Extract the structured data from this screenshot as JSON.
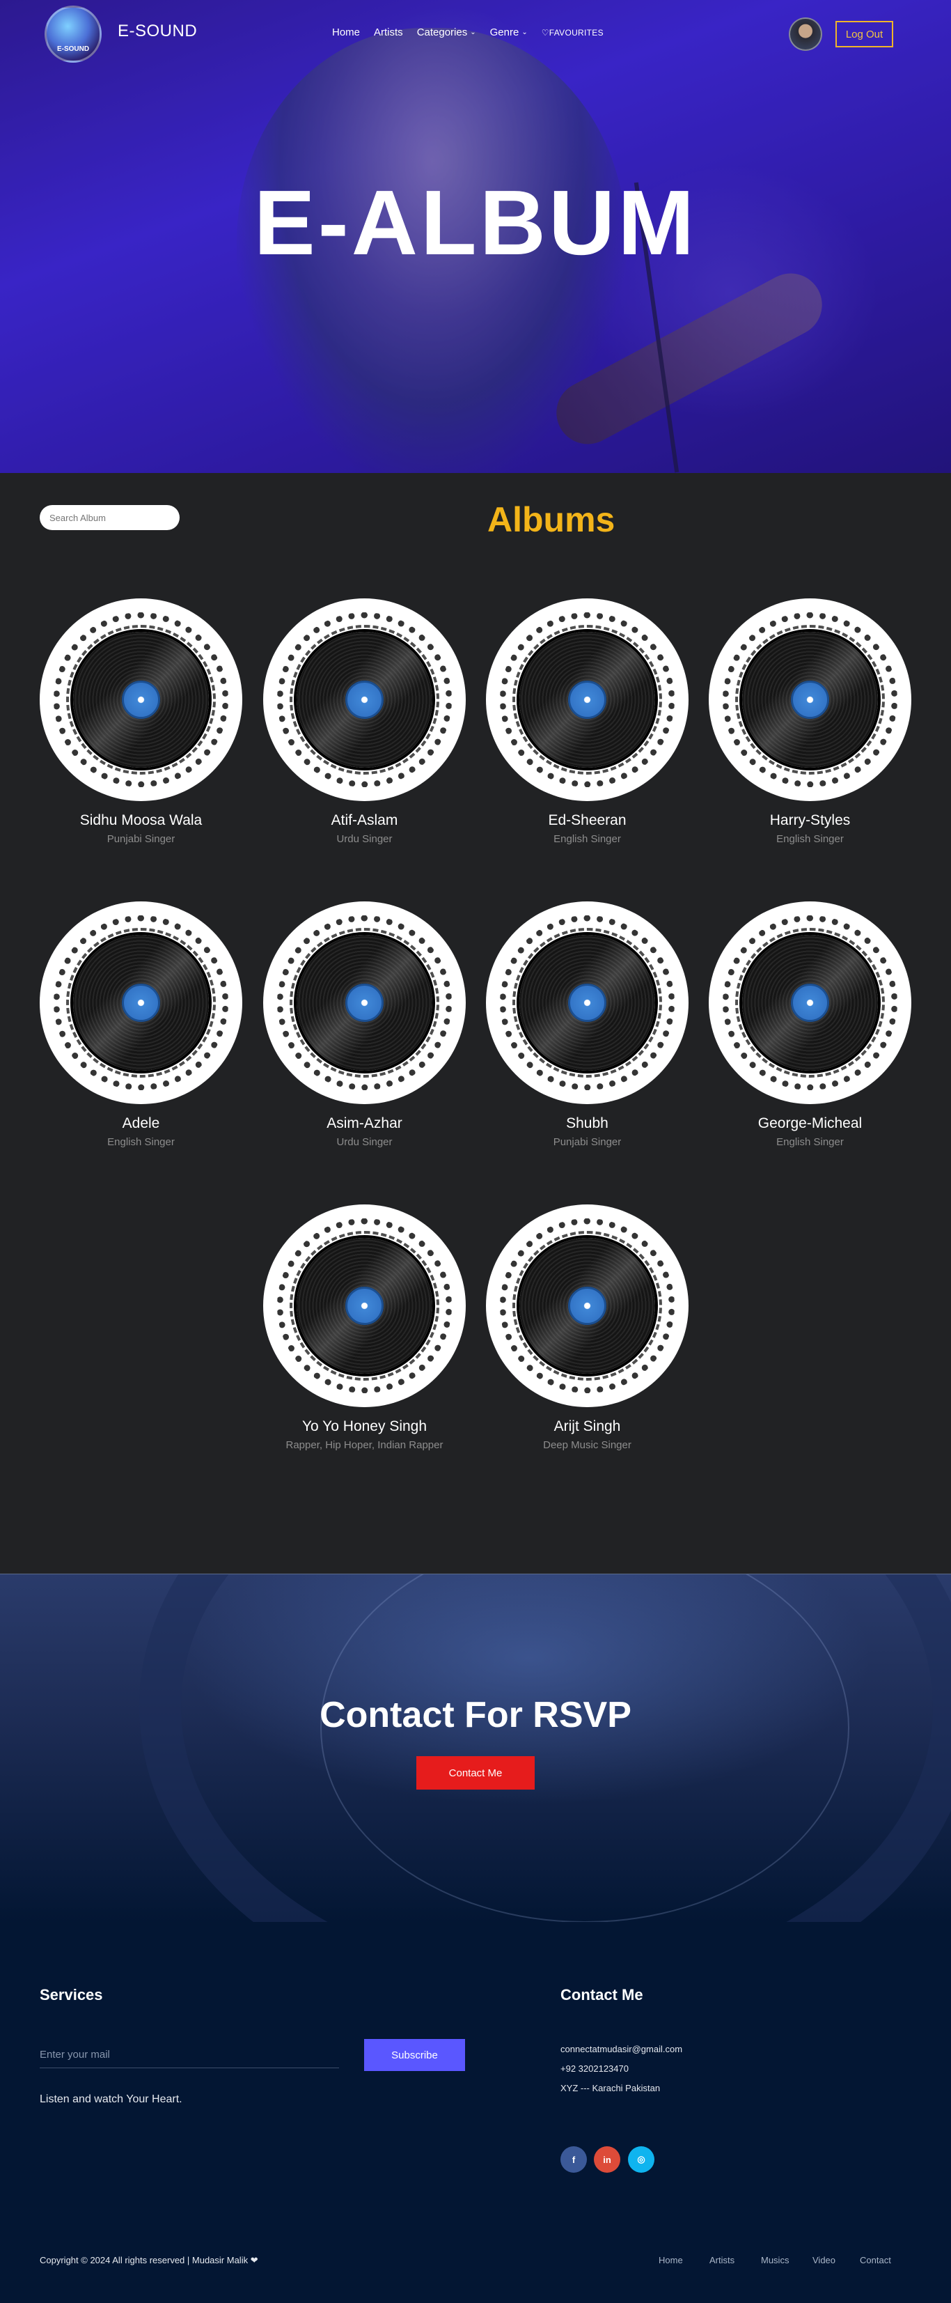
{
  "nav": {
    "logo_text": "E-SOUND",
    "brand": "E-SOUND",
    "links": [
      {
        "label": "Home"
      },
      {
        "label": "Artists"
      },
      {
        "label": "Categories",
        "dropdown": true
      },
      {
        "label": "Genre",
        "dropdown": true
      },
      {
        "label": "♡FAVOURITES"
      }
    ],
    "logout_label": "Log Out"
  },
  "hero": {
    "title": "E-ALBUM"
  },
  "albums": {
    "search_placeholder": "Search Album",
    "title": "Albums",
    "items": [
      {
        "name": "Sidhu Moosa Wala",
        "subtitle": "Punjabi Singer"
      },
      {
        "name": "Atif-Aslam",
        "subtitle": "Urdu Singer"
      },
      {
        "name": "Ed-Sheeran",
        "subtitle": "English Singer"
      },
      {
        "name": "Harry-Styles",
        "subtitle": "English Singer"
      },
      {
        "name": "Adele",
        "subtitle": "English Singer"
      },
      {
        "name": "Asim-Azhar",
        "subtitle": "Urdu Singer"
      },
      {
        "name": "Shubh",
        "subtitle": "Punjabi Singer"
      },
      {
        "name": "George-Micheal",
        "subtitle": "English Singer"
      },
      {
        "name": "Yo Yo Honey Singh",
        "subtitle": "Rapper, Hip Hoper, Indian Rapper"
      },
      {
        "name": "Arijt Singh",
        "subtitle": "Deep Music Singer"
      }
    ]
  },
  "contact": {
    "title": "Contact For RSVP",
    "button": "Contact Me"
  },
  "footer": {
    "services_title": "Services",
    "email_placeholder": "Enter your mail",
    "subscribe": "Subscribe",
    "tagline": "Listen and watch Your Heart.",
    "contact_title": "Contact Me",
    "email": "connectatmudasir@gmail.com",
    "phone": "+92 3202123470",
    "address": "XYZ --- Karachi Pakistan",
    "social": [
      {
        "icon": "facebook-icon",
        "glyph": "f",
        "color": "#3b5998"
      },
      {
        "icon": "linkedin-icon",
        "glyph": "in",
        "color": "#dd4b39"
      },
      {
        "icon": "instagram-icon",
        "glyph": "◎",
        "color": "#0fb4ef"
      }
    ],
    "copyright": "Copyright © 2024 All rights reserved | Mudasir Malik ❤",
    "links": [
      "Home",
      "Artists",
      "Musics",
      "Video",
      "Contact"
    ]
  },
  "colors": {
    "accent_gold": "#f3b419",
    "contact_red": "#e61c1c",
    "subscribe_blue": "#5a57ff",
    "footer_bg": "#031633"
  }
}
